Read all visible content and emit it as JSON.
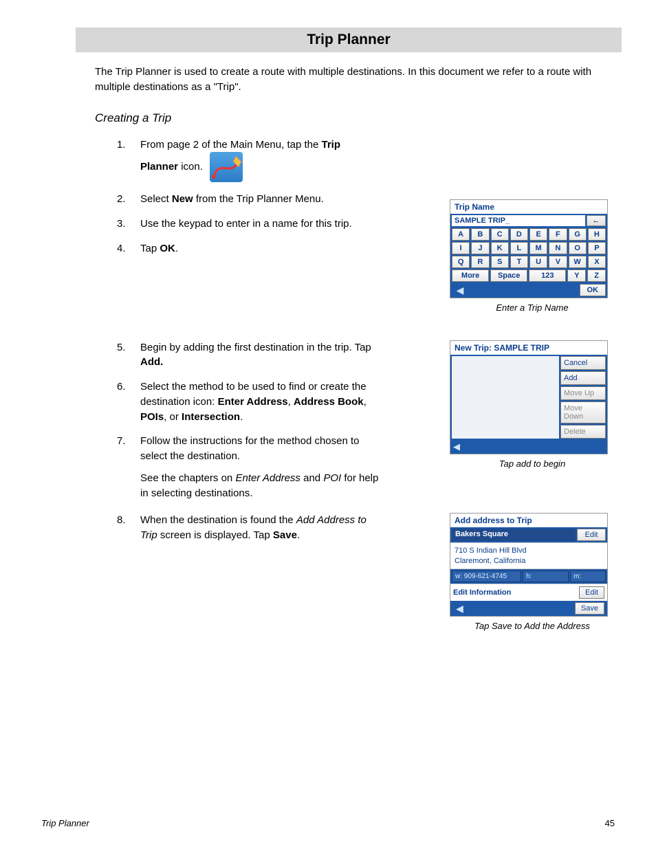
{
  "header": "Trip Planner",
  "intro": "The Trip Planner is used to create a route with multiple destinations.  In this document we refer to a route with multiple destinations as a \"Trip\".",
  "section": "Creating a Trip",
  "steps": {
    "s1_a": "From page 2 of the Main Menu, tap the ",
    "s1_b": "Trip Planner",
    "s1_c": " icon.",
    "s2_a": "Select ",
    "s2_b": "New",
    "s2_c": " from the Trip Planner Menu.",
    "s3": "Use the keypad to enter in a name for this trip.",
    "s4_a": "Tap ",
    "s4_b": "OK",
    "s4_c": ".",
    "s5_a": "Begin by adding the first destination in the trip.  Tap ",
    "s5_b": "Add.",
    "s6_a": "Select the method to be used to find or create the destination icon: ",
    "s6_b": "Enter Address",
    "s6_c": ", ",
    "s6_d": "Address Book",
    "s6_e": ", ",
    "s6_f": "POIs",
    "s6_g": ", or ",
    "s6_h": "Intersection",
    "s6_i": ".",
    "s7": "Follow the instructions for the method chosen to select the destination.",
    "s7x_a": "See the chapters on ",
    "s7x_b": "Enter Address",
    "s7x_c": " and ",
    "s7x_d": "POI",
    "s7x_e": " for help in selecting destinations.",
    "s8_a": "When the destination is found the ",
    "s8_b": "Add Address to Trip",
    "s8_c": " screen is displayed.  Tap ",
    "s8_d": "Save",
    "s8_e": "."
  },
  "keypad": {
    "title": "Trip Name",
    "value": "SAMPLE TRIP_",
    "back": "←",
    "rows": [
      [
        "A",
        "B",
        "C",
        "D",
        "E",
        "F",
        "G",
        "H"
      ],
      [
        "I",
        "J",
        "K",
        "L",
        "M",
        "N",
        "O",
        "P"
      ],
      [
        "Q",
        "R",
        "S",
        "T",
        "U",
        "V",
        "W",
        "X"
      ]
    ],
    "row4": {
      "more": "More",
      "space": "Space",
      "num": "123",
      "y": "Y",
      "z": "Z"
    },
    "ok": "OK",
    "caption": "Enter a Trip Name"
  },
  "newtrip": {
    "title": "New Trip: SAMPLE TRIP",
    "buttons": [
      "Cancel",
      "Add",
      "Move Up",
      "Move Down",
      "Delete"
    ],
    "caption": "Tap add to begin"
  },
  "addaddr": {
    "title": "Add address to Trip",
    "name": "Bakers Square",
    "edit": "Edit",
    "line1": "710 S Indian Hill Blvd",
    "line2": "Claremont, California",
    "w": "w: 909-621-4745",
    "h": "h:",
    "m": "m:",
    "editinfo": "Edit Information",
    "save": "Save",
    "caption": "Tap Save to Add the Address"
  },
  "footer": {
    "title": "Trip Planner",
    "page": "45"
  }
}
